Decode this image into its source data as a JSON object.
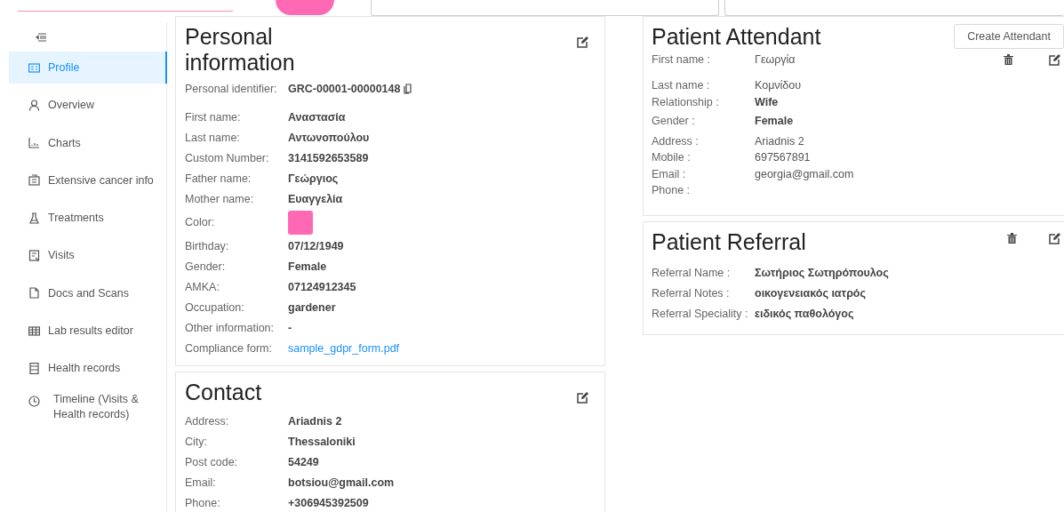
{
  "sidebar": {
    "items": [
      {
        "label": "Profile",
        "selected": true
      },
      {
        "label": "Overview",
        "selected": false
      },
      {
        "label": "Charts",
        "selected": false
      },
      {
        "label": "Extensive cancer info",
        "selected": false
      },
      {
        "label": "Treatments",
        "selected": false
      },
      {
        "label": "Visits",
        "selected": false
      },
      {
        "label": "Docs and Scans",
        "selected": false
      },
      {
        "label": "Lab results editor",
        "selected": false
      },
      {
        "label": "Health records",
        "selected": false
      },
      {
        "label": "Timeline (Visits & Health records)",
        "selected": false
      }
    ]
  },
  "personal_information": {
    "title": "Personal information",
    "identifier": {
      "label": "Personal identifier:",
      "value": "GRC-00001-00000148"
    },
    "rows": [
      {
        "kind": "text",
        "label": "First name:",
        "value": "Αναστασία"
      },
      {
        "kind": "text",
        "label": "Last name:",
        "value": "Αντωνοπούλου"
      },
      {
        "kind": "text",
        "label": "Custom Number:",
        "value": "3141592653589"
      },
      {
        "kind": "text",
        "label": "Father name:",
        "value": "Γεώργιος"
      },
      {
        "kind": "text",
        "label": "Mother name:",
        "value": "Ευαγγελία"
      },
      {
        "kind": "color",
        "label": "Color:",
        "color": "#ff69b4"
      },
      {
        "kind": "text",
        "label": "Birthday:",
        "value": "07/12/1949"
      },
      {
        "kind": "text",
        "label": "Gender:",
        "value": "Female"
      },
      {
        "kind": "text",
        "label": "AMKA:",
        "value": "07124912345"
      },
      {
        "kind": "text",
        "label": "Occupation:",
        "value": "gardener"
      },
      {
        "kind": "text",
        "label": "Other information:",
        "value": "-"
      },
      {
        "kind": "link",
        "label": "Compliance form:",
        "value": "sample_gdpr_form.pdf"
      }
    ]
  },
  "contact": {
    "title": "Contact",
    "rows": [
      {
        "label": "Address:",
        "value": "Ariadnis 2"
      },
      {
        "label": "City:",
        "value": "Thessaloniki"
      },
      {
        "label": "Post code:",
        "value": "54249"
      },
      {
        "label": "Email:",
        "value": "botsiou@gmail.com"
      },
      {
        "label": "Phone:",
        "value": "+306945392509"
      }
    ]
  },
  "patient_attendant": {
    "title": "Patient Attendant",
    "create_button": "Create Attendant",
    "rows": [
      {
        "label": "First name :",
        "value": "Γεωργία",
        "bold": false
      },
      {
        "label": "Last name :",
        "value": "Κομνίδου",
        "bold": false
      },
      {
        "label": "Relationship :",
        "value": "Wife",
        "bold": true
      },
      {
        "label": "Gender :",
        "value": "Female",
        "bold": true
      },
      {
        "label": "Address :",
        "value": "Ariadnis 2",
        "bold": false
      },
      {
        "label": "Mobile :",
        "value": "697567891",
        "bold": false
      },
      {
        "label": "Email :",
        "value": "georgia@gmail.com",
        "bold": false
      },
      {
        "label": "Phone :"
      }
    ]
  },
  "patient_referral": {
    "title": "Patient Referral",
    "rows": [
      {
        "label": "Referral Name :",
        "value": "Σωτήριος Σωτηρόπουλος"
      },
      {
        "label": "Referral Notes :",
        "value": "οικογενειακός ιατρός"
      },
      {
        "label": "Referral Speciality :",
        "value": "ειδικός παθολόγος"
      }
    ]
  }
}
